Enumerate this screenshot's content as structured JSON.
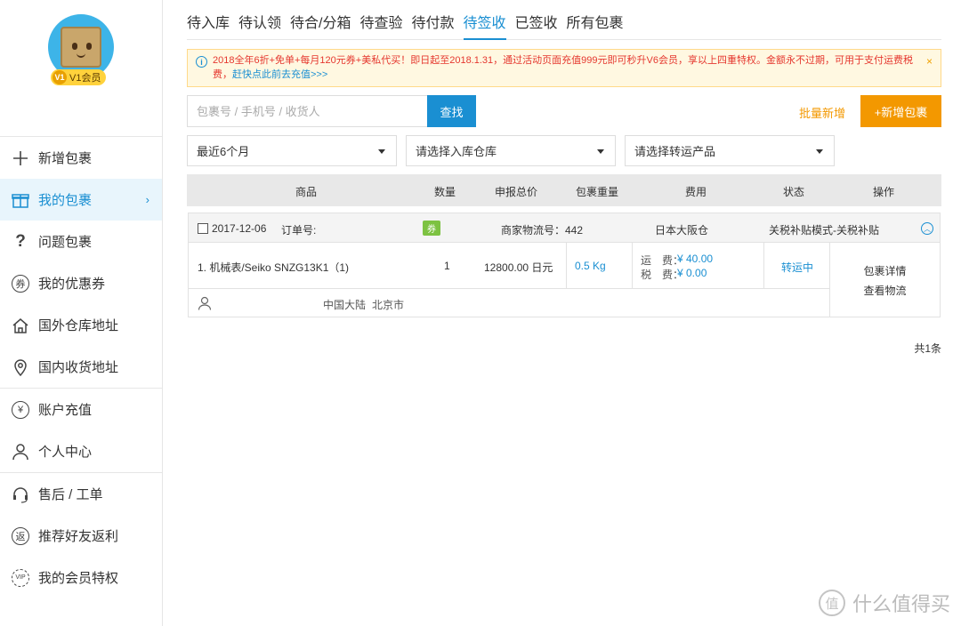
{
  "user": {
    "level_badge": "V1",
    "member_label": "V1会员"
  },
  "sidebar": {
    "items": [
      {
        "label": "新增包裹",
        "icon": "plus-icon"
      },
      {
        "label": "我的包裹",
        "icon": "gift-box-icon",
        "active": true
      },
      {
        "label": "问题包裹",
        "icon": "question-icon"
      },
      {
        "label": "我的优惠券",
        "icon": "coupon-icon"
      },
      {
        "label": "国外仓库地址",
        "icon": "house-icon"
      },
      {
        "label": "国内收货地址",
        "icon": "location-pin-icon"
      },
      {
        "label": "账户充值",
        "icon": "yen-icon"
      },
      {
        "label": "个人中心",
        "icon": "person-icon"
      },
      {
        "label": "售后 / 工单",
        "icon": "headset-icon"
      },
      {
        "label": "推荐好友返利",
        "icon": "rebate-icon"
      },
      {
        "label": "我的会员特权",
        "icon": "vip-icon"
      }
    ],
    "icon_glyphs": {
      "coupon": "券",
      "rebate": "返",
      "vip": "VIP",
      "yen": "¥"
    }
  },
  "tabs": [
    "待入库",
    "待认领",
    "待合/分箱",
    "待查验",
    "待付款",
    "待签收",
    "已签收",
    "所有包裹"
  ],
  "active_tab": "待签收",
  "notice": {
    "text": "2018全年6折+免单+每月120元券+美私代买！即日起至2018.1.31，通过活动页面充值999元即可秒升V6会员，享以上四重特权。金额永不过期，可用于支付运费税费，",
    "link": "赶快点此前去充值>>>",
    "close_glyph": "×"
  },
  "search": {
    "placeholder": "包裹号 / 手机号 / 收货人",
    "button": "查找",
    "batch_label": "批量新增",
    "add_button": "+新增包裹"
  },
  "filters": [
    "最近6个月",
    "请选择入库仓库",
    "请选择转运产品"
  ],
  "table": {
    "headers": [
      "商品",
      "数量",
      "申报总价",
      "包裹重量",
      "费用",
      "状态",
      "操作"
    ]
  },
  "order": {
    "date": "2017-12-06",
    "order_no_label": "订单号:",
    "coupon_label": "券",
    "merchant_label": "商家物流号：442",
    "warehouse": "日本大阪仓",
    "tax_mode": "关税补贴模式-关税补贴",
    "item": "1. 机械表/Seiko SNZG13K1（1)",
    "quantity": "1",
    "declared_total": "12800.00 日元",
    "weight": "0.5 Kg",
    "shipping_label": "运　费：",
    "shipping_value": "¥ 40.00",
    "tax_label": "税　费：",
    "tax_value": "¥ 0.00",
    "status": "转运中",
    "action_detail": "包裹详情",
    "action_track": "查看物流",
    "country": "中国大陆",
    "city": "北京市"
  },
  "pagination": {
    "total": "共1条"
  },
  "watermark": {
    "logo_glyph": "值",
    "text": "什么值得买"
  },
  "colors": {
    "accent": "#1a8fd2",
    "orange": "#f39800",
    "notice_red": "#e5372e",
    "coupon_green": "#7dc242"
  }
}
